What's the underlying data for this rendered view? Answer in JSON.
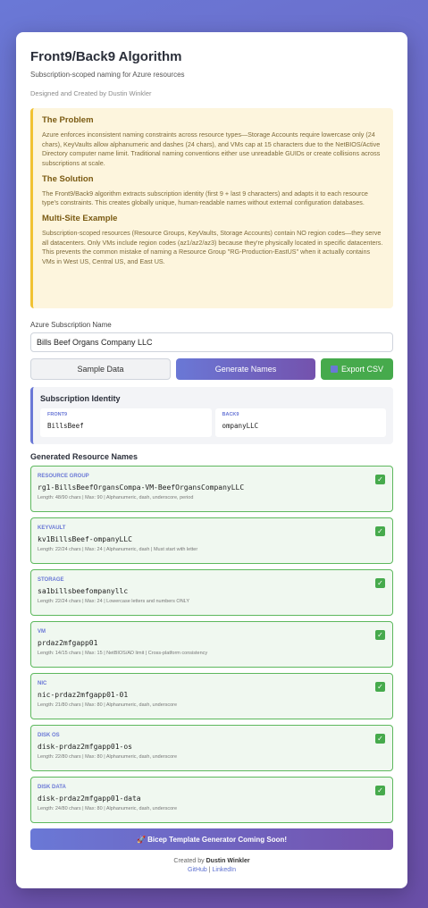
{
  "header": {
    "title": "Front9/Back9 Algorithm",
    "subtitle": "Subscription-scoped naming for Azure resources",
    "credit": "Designed and Created by Dustin Winkler"
  },
  "info": {
    "problem_title": "The Problem",
    "problem_text": "Azure enforces inconsistent naming constraints across resource types—Storage Accounts require lowercase only (24 chars), KeyVaults allow alphanumeric and dashes (24 chars), and VMs cap at 15 characters due to the NetBIOS/Active Directory computer name limit. Traditional naming conventions either use unreadable GUIDs or create collisions across subscriptions at scale.",
    "solution_title": "The Solution",
    "solution_text": "The Front9/Back9 algorithm extracts subscription identity (first 9 + last 9 characters) and adapts it to each resource type's constraints. This creates globally unique, human-readable names without external configuration databases.",
    "example_title": "Multi-Site Example",
    "example_text": "Subscription-scoped resources (Resource Groups, KeyVaults, Storage Accounts) contain NO region codes—they serve all datacenters. Only VMs include region codes (az1/az2/az3) because they're physically located in specific datacenters. This prevents the common mistake of naming a Resource Group \"RG-Production-EastUS\" when it actually contains VMs in West US, Central US, and East US."
  },
  "form": {
    "label": "Azure Subscription Name",
    "value": "Bills Beef Organs Company LLC",
    "sample_label": "Sample Data",
    "generate_label": "Generate Names",
    "export_label": "Export CSV"
  },
  "identity": {
    "title": "Subscription Identity",
    "front_label": "FRONT9",
    "front_value": "BillsBeef",
    "back_label": "BACK9",
    "back_value": "ompanyLLC"
  },
  "results": {
    "title": "Generated Resource Names",
    "items": [
      {
        "type": "RESOURCE GROUP",
        "name": "rg1-BillsBeefOrgansCompa-VM-BeefOrgansCompanyLLC",
        "meta": "Length: 48/90 chars | Max: 90 | Alphanumeric, dash, underscore, period"
      },
      {
        "type": "KEYVAULT",
        "name": "kv1BillsBeef-ompanyLLC",
        "meta": "Length: 22/24 chars | Max: 24 | Alphanumeric, dash | Must start with letter"
      },
      {
        "type": "STORAGE",
        "name": "sa1billsbeefompanyllc",
        "meta": "Length: 22/24 chars | Max: 24 | Lowercase letters and numbers ONLY"
      },
      {
        "type": "VM",
        "name": "prdaz2mfgapp01",
        "meta": "Length: 14/15 chars | Max: 15 | NetBIOS/AD limit | Cross-platform consistency"
      },
      {
        "type": "NIC",
        "name": "nic-prdaz2mfgapp01-01",
        "meta": "Length: 21/80 chars | Max: 80 | Alphanumeric, dash, underscore"
      },
      {
        "type": "DISK OS",
        "name": "disk-prdaz2mfgapp01-os",
        "meta": "Length: 22/80 chars | Max: 80 | Alphanumeric, dash, underscore"
      },
      {
        "type": "DISK DATA",
        "name": "disk-prdaz2mfgapp01-data",
        "meta": "Length: 24/80 chars | Max: 80 | Alphanumeric, dash, underscore"
      }
    ]
  },
  "bicep_label": "🚀 Bicep Template Generator Coming Soon!",
  "footer": {
    "created_by": "Created by",
    "author": "Dustin Winkler",
    "github": "GitHub",
    "separator": "|",
    "linkedin": "LinkedIn"
  },
  "colors": {
    "accent": "#6a78d6",
    "success": "#46aa4c",
    "info_bg": "#fdf5dd"
  }
}
